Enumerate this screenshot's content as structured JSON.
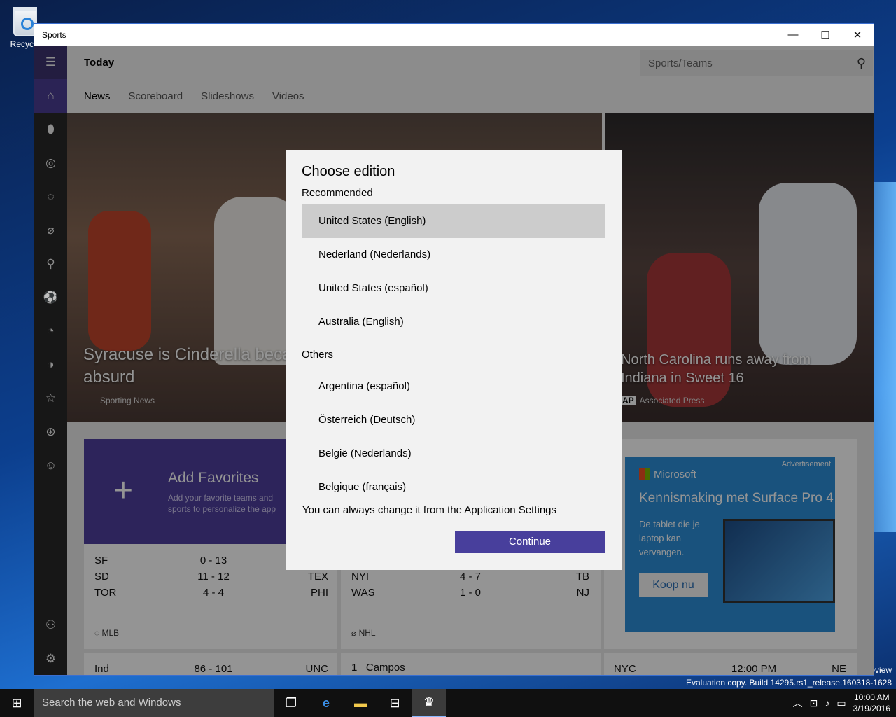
{
  "desktop": {
    "recycle_label": "Recycle",
    "build_line1": "eview",
    "build_line2": "Evaluation copy. Build 14295.rs1_release.160318-1628"
  },
  "window": {
    "title": "Sports",
    "minimize": "—",
    "maximize": "☐",
    "close": "✕"
  },
  "header": {
    "title": "Today",
    "search_placeholder": "Sports/Teams",
    "tabs": [
      "News",
      "Scoreboard",
      "Slideshows",
      "Videos"
    ]
  },
  "hero": {
    "left_caption": "Syracuse is Cinderella becau\nabsurd",
    "left_source": "Sporting News",
    "right_caption": "North Carolina runs away from\nIndiana in Sweet 16",
    "right_source": "Associated Press",
    "right_badge": "AP"
  },
  "favorites": {
    "title": "Add Favorites",
    "desc": "Add your favorite teams and sports to personalize the app"
  },
  "scores": {
    "mlb": {
      "league": "MLB",
      "rows": [
        {
          "a": "SF",
          "s1": "0",
          "s2": "13",
          "b": ""
        },
        {
          "a": "SD",
          "s1": "11",
          "s2": "12",
          "b": "TEX"
        },
        {
          "a": "TOR",
          "s1": "4",
          "s2": "4",
          "b": "PHI"
        }
      ]
    },
    "nhl": {
      "league": "NHL",
      "rows": [
        {
          "a": "NYI",
          "s1": "4",
          "s2": "7",
          "b": "TB"
        },
        {
          "a": "WAS",
          "s1": "1",
          "s2": "0",
          "b": "NJ"
        }
      ]
    },
    "bottom": {
      "c1": {
        "a": "Ind",
        "s1": "86",
        "s2": "101",
        "b": "UNC"
      },
      "c2": {
        "rank": "1",
        "name": "Campos"
      },
      "c3": {
        "a": "NYC",
        "time": "12:00 PM",
        "b": "NE"
      }
    }
  },
  "ad": {
    "tag": "Advertisement",
    "brand": "Microsoft",
    "headline": "Kennismaking met Surface Pro 4",
    "desc": "De tablet die je laptop kan vervangen.",
    "cta": "Koop nu"
  },
  "dialog": {
    "title": "Choose edition",
    "recommended_label": "Recommended",
    "recommended": [
      "United States (English)",
      "Nederland (Nederlands)",
      "United States (español)",
      "Australia (English)"
    ],
    "others_label": "Others",
    "others": [
      "Argentina (español)",
      "Österreich (Deutsch)",
      "België (Nederlands)",
      "Belgique (français)"
    ],
    "note": "You can always change it from the Application Settings",
    "continue": "Continue"
  },
  "taskbar": {
    "search_placeholder": "Search the web and Windows",
    "time": "10:00 AM",
    "date": "3/19/2016"
  },
  "colors": {
    "accent": "#483f9c",
    "rail_selected": "#3a2f72",
    "favorites_tile": "#4e3f9e",
    "ad_bg": "#2b8ed8"
  }
}
